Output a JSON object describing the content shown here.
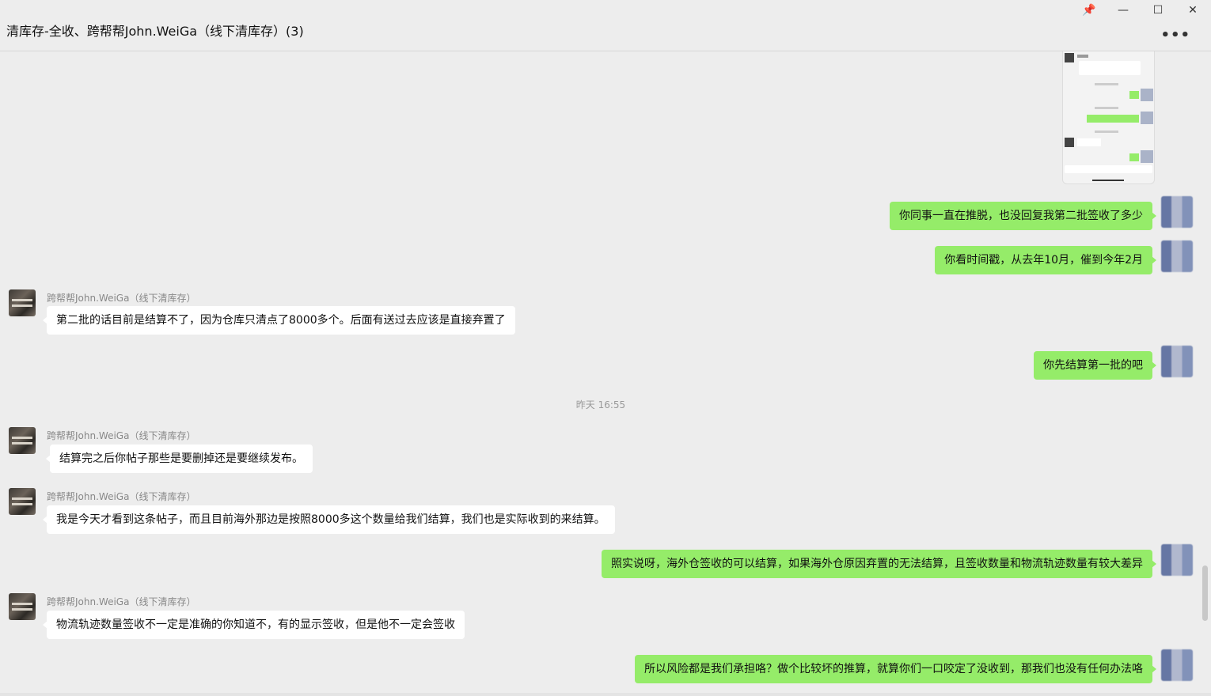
{
  "window": {
    "title": "清库存-全收、跨帮帮John.WeiGa（线下清库存）(3)",
    "controls": {
      "pin": "📌",
      "minimize": "—",
      "maximize": "☐",
      "close": "✕"
    },
    "more": "•••"
  },
  "colors": {
    "background": "#ededed",
    "my_bubble": "#95ec69",
    "their_bubble": "#ffffff",
    "timestamp": "#999999"
  },
  "messages": [
    {
      "from": "me",
      "text": "你同事一直在推脱，也没回复我第二批签收了多少"
    },
    {
      "from": "me",
      "text": "你看时间戳，从去年10月，催到今年2月"
    },
    {
      "from": "them",
      "sender": "跨帮帮John.WeiGa（线下清库存）",
      "text": "第二批的话目前是结算不了，因为仓库只清点了8000多个。后面有送过去应该是直接弃置了"
    },
    {
      "from": "me",
      "text": "你先结算第一批的吧"
    },
    {
      "from": "them",
      "sender": "跨帮帮John.WeiGa（线下清库存）",
      "text": "结算完之后你帖子那些是要删掉还是要继续发布。"
    },
    {
      "from": "them",
      "sender": "跨帮帮John.WeiGa（线下清库存）",
      "text": "我是今天才看到这条帖子，而且目前海外那边是按照8000多这个数量给我们结算，我们也是实际收到的来结算。"
    },
    {
      "from": "me",
      "text": "照实说呀，海外仓签收的可以结算，如果海外仓原因弃置的无法结算，且签收数量和物流轨迹数量有较大差异"
    },
    {
      "from": "them",
      "sender": "跨帮帮John.WeiGa（线下清库存）",
      "text": "物流轨迹数量签收不一定是准确的你知道不，有的显示签收，但是他不一定会签收"
    },
    {
      "from": "me",
      "text": "所以风险都是我们承担咯？做个比较坏的推算，就算你们一口咬定了没收到，那我们也没有任何办法咯"
    }
  ],
  "timestamp_label": "昨天 16:55"
}
